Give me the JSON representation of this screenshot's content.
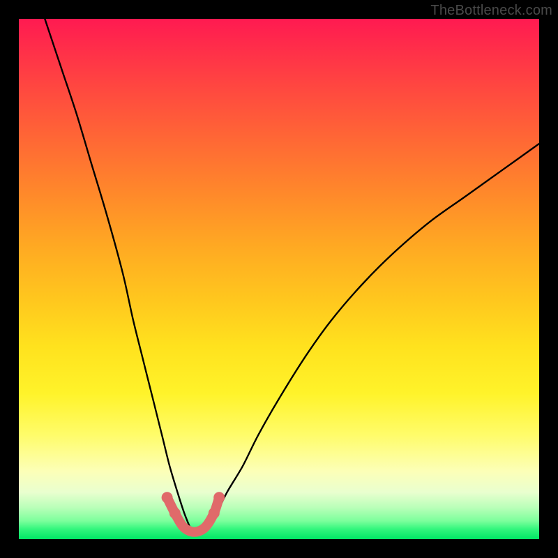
{
  "watermark": "TheBottleneck.com",
  "colors": {
    "gradient_top": "#ff1a51",
    "gradient_mid": "#ffe21e",
    "gradient_bottom": "#00e765",
    "curve": "#000000",
    "marker": "#e06a6a",
    "frame": "#000000"
  },
  "chart_data": {
    "type": "line",
    "title": "",
    "xlabel": "",
    "ylabel": "",
    "xlim": [
      0,
      100
    ],
    "ylim": [
      0,
      100
    ],
    "legend": false,
    "grid": false,
    "annotations": [
      "TheBottleneck.com"
    ],
    "series": [
      {
        "name": "left-curve",
        "x": [
          5,
          8,
          11,
          14,
          17,
          20,
          22,
          24,
          26,
          27.5,
          29,
          30.5,
          31.8,
          33
        ],
        "y": [
          100,
          91,
          82,
          72,
          62,
          51,
          42,
          34,
          26,
          20,
          14,
          9,
          5,
          2
        ]
      },
      {
        "name": "right-curve",
        "x": [
          36,
          38,
          40,
          43,
          46,
          50,
          55,
          60,
          66,
          72,
          79,
          86,
          93,
          100
        ],
        "y": [
          2,
          5,
          9,
          14,
          20,
          27,
          35,
          42,
          49,
          55,
          61,
          66,
          71,
          76
        ]
      },
      {
        "name": "valley-floor",
        "x": [
          33,
          34,
          35,
          36
        ],
        "y": [
          2,
          1,
          1,
          2
        ]
      }
    ],
    "markers": {
      "name": "highlight-dots",
      "x": [
        28.5,
        30.0,
        31.5,
        33.0,
        34.5,
        36.0,
        37.5,
        38.5
      ],
      "y": [
        8.0,
        5.0,
        2.5,
        1.5,
        1.5,
        2.5,
        5.0,
        8.0
      ]
    }
  }
}
